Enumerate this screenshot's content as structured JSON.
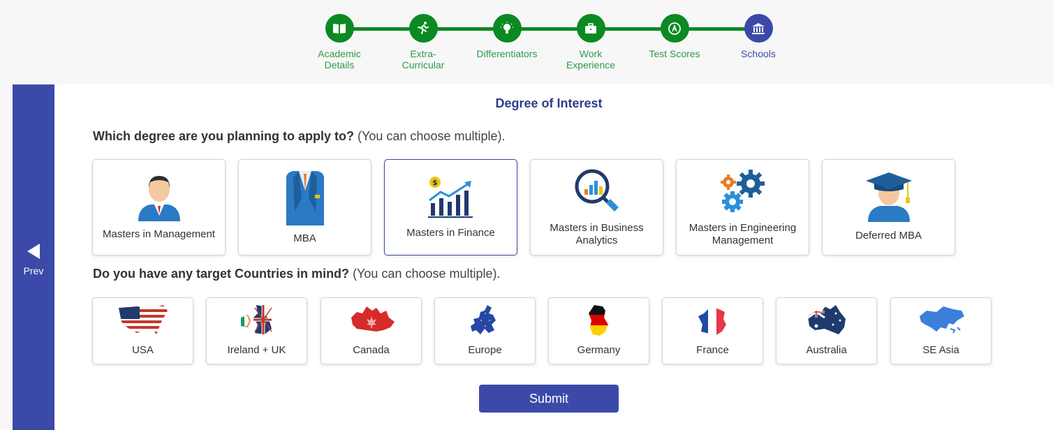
{
  "stepper": {
    "steps": [
      {
        "label": "Academic\nDetails",
        "status": "done",
        "icon": "book-icon"
      },
      {
        "label": "Extra-\nCurricular",
        "status": "done",
        "icon": "running-icon"
      },
      {
        "label": "Differentiators",
        "status": "done",
        "icon": "lightbulb-icon"
      },
      {
        "label": "Work\nExperience",
        "status": "done",
        "icon": "briefcase-icon"
      },
      {
        "label": "Test Scores",
        "status": "done",
        "icon": "grade-icon"
      },
      {
        "label": "Schools",
        "status": "current",
        "icon": "institution-icon"
      }
    ],
    "colors": {
      "done": "#0b8a23",
      "done_text": "#2e9a4a",
      "current": "#3b4aa8",
      "current_text": "#3b4aa8"
    }
  },
  "nav": {
    "prev_label": "Prev"
  },
  "form": {
    "title": "Degree of Interest",
    "degree_question": {
      "bold": "Which degree are you planning to apply to?",
      "note": " (You can choose multiple)."
    },
    "degrees": [
      {
        "label": "Masters in Management",
        "icon": "manager-icon",
        "selected": false
      },
      {
        "label": "MBA",
        "icon": "business-suit-icon",
        "selected": false
      },
      {
        "label": "Masters in Finance",
        "icon": "finance-chart-icon",
        "selected": true
      },
      {
        "label": "Masters in Business Analytics",
        "icon": "analytics-magnifier-icon",
        "selected": false
      },
      {
        "label": "Masters in Engineering Management",
        "icon": "gears-icon",
        "selected": false
      },
      {
        "label": "Deferred MBA",
        "icon": "graduate-icon",
        "selected": false
      }
    ],
    "country_question": {
      "bold": "Do you have any target Countries in mind?",
      "note": " (You can choose multiple)."
    },
    "countries": [
      {
        "label": "USA",
        "icon": "usa-map-icon"
      },
      {
        "label": "Ireland + UK",
        "icon": "ireland-uk-map-icon"
      },
      {
        "label": "Canada",
        "icon": "canada-map-icon"
      },
      {
        "label": "Europe",
        "icon": "europe-map-icon"
      },
      {
        "label": "Germany",
        "icon": "germany-map-icon"
      },
      {
        "label": "France",
        "icon": "france-map-icon"
      },
      {
        "label": "Australia",
        "icon": "australia-map-icon"
      },
      {
        "label": "SE Asia",
        "icon": "se-asia-map-icon"
      }
    ],
    "submit_label": "Submit"
  },
  "colors": {
    "primary": "#3b4aa8",
    "success": "#0b8a23",
    "title": "#2e3d8c"
  }
}
